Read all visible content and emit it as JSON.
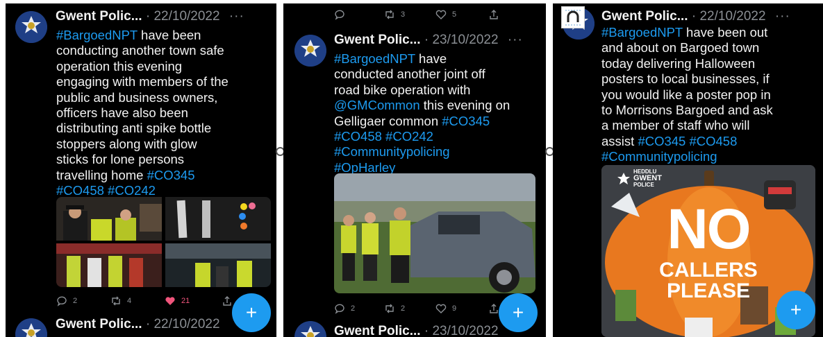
{
  "author": "Gwent Polic...",
  "more": "···",
  "fab_label": "+",
  "panel1": {
    "tweet": {
      "date": "· 22/10/2022",
      "lines": [
        [
          {
            "t": "#BargoedNPT",
            "tag": true
          },
          {
            "t": " have been"
          }
        ],
        [
          {
            "t": "conducting another town safe"
          }
        ],
        [
          {
            "t": "operation this evening"
          }
        ],
        [
          {
            "t": "engaging with members of the"
          }
        ],
        [
          {
            "t": "public and business owners,"
          }
        ],
        [
          {
            "t": "officers have also been"
          }
        ],
        [
          {
            "t": "distributing anti spike bottle"
          }
        ],
        [
          {
            "t": "stoppers along with glow"
          }
        ],
        [
          {
            "t": "sticks for lone persons"
          }
        ],
        [
          {
            "t": "travelling home "
          },
          {
            "t": "#CO345",
            "tag": true
          }
        ],
        [
          {
            "t": "#CO458 #CO242",
            "tag": true
          }
        ]
      ],
      "replies": "2",
      "retweets": "4",
      "likes": "21"
    },
    "next": {
      "date": "· 22/10/2022"
    }
  },
  "panel2": {
    "top_actions": {
      "replies": "",
      "retweets": "3",
      "likes": "5"
    },
    "tweet": {
      "date": "· 23/10/2022",
      "lines": [
        [
          {
            "t": "#BargoedNPT",
            "tag": true
          },
          {
            "t": " have"
          }
        ],
        [
          {
            "t": "conducted another joint off"
          }
        ],
        [
          {
            "t": "road bike  operation with"
          }
        ],
        [
          {
            "t": "@GMCommon",
            "tag": true
          },
          {
            "t": " this evening on"
          }
        ],
        [
          {
            "t": "Gelligaer common "
          },
          {
            "t": "#CO345",
            "tag": true
          }
        ],
        [
          {
            "t": "#CO458 #CO242",
            "tag": true
          }
        ],
        [
          {
            "t": "#Communitypolicing",
            "tag": true
          }
        ],
        [
          {
            "t": "#OpHarley",
            "tag": true
          }
        ]
      ],
      "replies": "2",
      "retweets": "2",
      "likes": "9"
    },
    "next": {
      "date": "· 23/10/2022"
    }
  },
  "panel3": {
    "tweet": {
      "date": "· 22/10/2022",
      "lines": [
        [
          {
            "t": "#BargoedNPT",
            "tag": true
          },
          {
            "t": " have been out"
          }
        ],
        [
          {
            "t": "and about on Bargoed town"
          }
        ],
        [
          {
            "t": "today delivering Halloween"
          }
        ],
        [
          {
            "t": "posters to local businesses, if"
          }
        ],
        [
          {
            "t": "you would like a poster pop in"
          }
        ],
        [
          {
            "t": "to Morrisons Bargoed and ask"
          }
        ],
        [
          {
            "t": "a member of staff who will"
          }
        ],
        [
          {
            "t": "assist "
          },
          {
            "t": "#CO345 #CO458",
            "tag": true
          }
        ],
        [
          {
            "t": "#Communitypolicing",
            "tag": true
          }
        ]
      ]
    },
    "poster": {
      "logo_lines": [
        "HEDDLU",
        "GWENT",
        "POLICE"
      ],
      "headline": "NO",
      "sub1": "CALLERS",
      "sub2": "PLEASE"
    }
  },
  "colors": {
    "accent": "#1d9bf0",
    "like": "#f0557c",
    "background": "#000000"
  },
  "icons": [
    "reply-icon",
    "retweet-icon",
    "like-icon",
    "share-icon",
    "plus-icon",
    "more-icon"
  ]
}
